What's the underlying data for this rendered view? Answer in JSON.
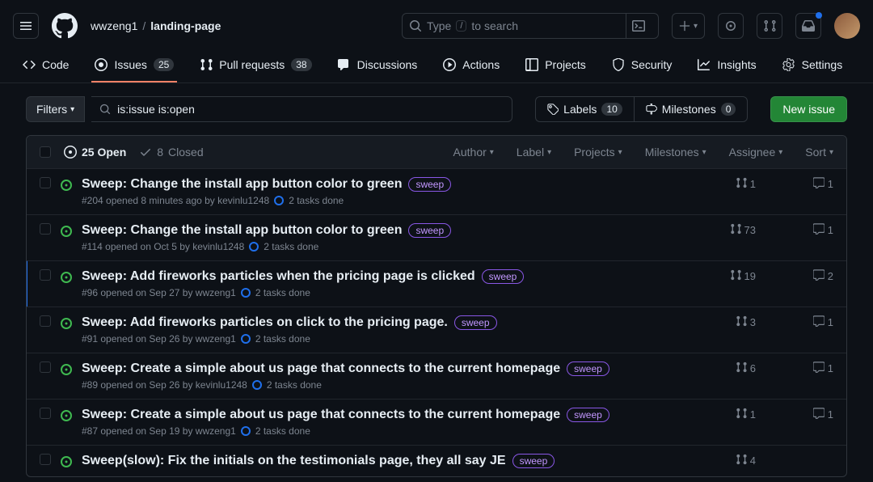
{
  "breadcrumb": {
    "owner": "wwzeng1",
    "repo": "landing-page"
  },
  "search": {
    "prefix": "Type",
    "slash": "/",
    "suffix": "to search"
  },
  "tabs": {
    "code": "Code",
    "issues": "Issues",
    "issues_count": "25",
    "pr": "Pull requests",
    "pr_count": "38",
    "discussions": "Discussions",
    "actions": "Actions",
    "projects": "Projects",
    "security": "Security",
    "insights": "Insights",
    "settings": "Settings"
  },
  "filters_label": "Filters",
  "filter_query": "is:issue is:open",
  "labels": {
    "text": "Labels",
    "count": "10"
  },
  "milestones": {
    "text": "Milestones",
    "count": "0"
  },
  "new_issue": "New issue",
  "open_state": {
    "count": "25",
    "label": "Open"
  },
  "closed_state": {
    "count": "8",
    "label": "Closed"
  },
  "head_filters": {
    "author": "Author",
    "label": "Label",
    "projects": "Projects",
    "milestones": "Milestones",
    "assignee": "Assignee",
    "sort": "Sort"
  },
  "sweep_label": "sweep",
  "issues": [
    {
      "title": "Sweep: Change the install app button color to green",
      "meta": "#204 opened 8 minutes ago by kevinlu1248",
      "tasks": "2 tasks done",
      "pr": "1",
      "comments": "1",
      "hi": false
    },
    {
      "title": "Sweep: Change the install app button color to green",
      "meta": "#114 opened on Oct 5 by kevinlu1248",
      "tasks": "2 tasks done",
      "pr": "73",
      "comments": "1",
      "hi": false
    },
    {
      "title": "Sweep: Add fireworks particles when the pricing page is clicked",
      "meta": "#96 opened on Sep 27 by wwzeng1",
      "tasks": "2 tasks done",
      "pr": "19",
      "comments": "2",
      "hi": true
    },
    {
      "title": "Sweep: Add fireworks particles on click to the pricing page.",
      "meta": "#91 opened on Sep 26 by wwzeng1",
      "tasks": "2 tasks done",
      "pr": "3",
      "comments": "1",
      "hi": false
    },
    {
      "title": "Sweep: Create a simple about us page that connects to the current homepage",
      "meta": "#89 opened on Sep 26 by kevinlu1248",
      "tasks": "2 tasks done",
      "pr": "6",
      "comments": "1",
      "hi": false
    },
    {
      "title": "Sweep: Create a simple about us page that connects to the current homepage",
      "meta": "#87 opened on Sep 19 by wwzeng1",
      "tasks": "2 tasks done",
      "pr": "1",
      "comments": "1",
      "hi": false
    },
    {
      "title": "Sweep(slow): Fix the initials on the testimonials page, they all say JE",
      "meta": "",
      "tasks": "",
      "pr": "4",
      "comments": "",
      "hi": false
    }
  ]
}
